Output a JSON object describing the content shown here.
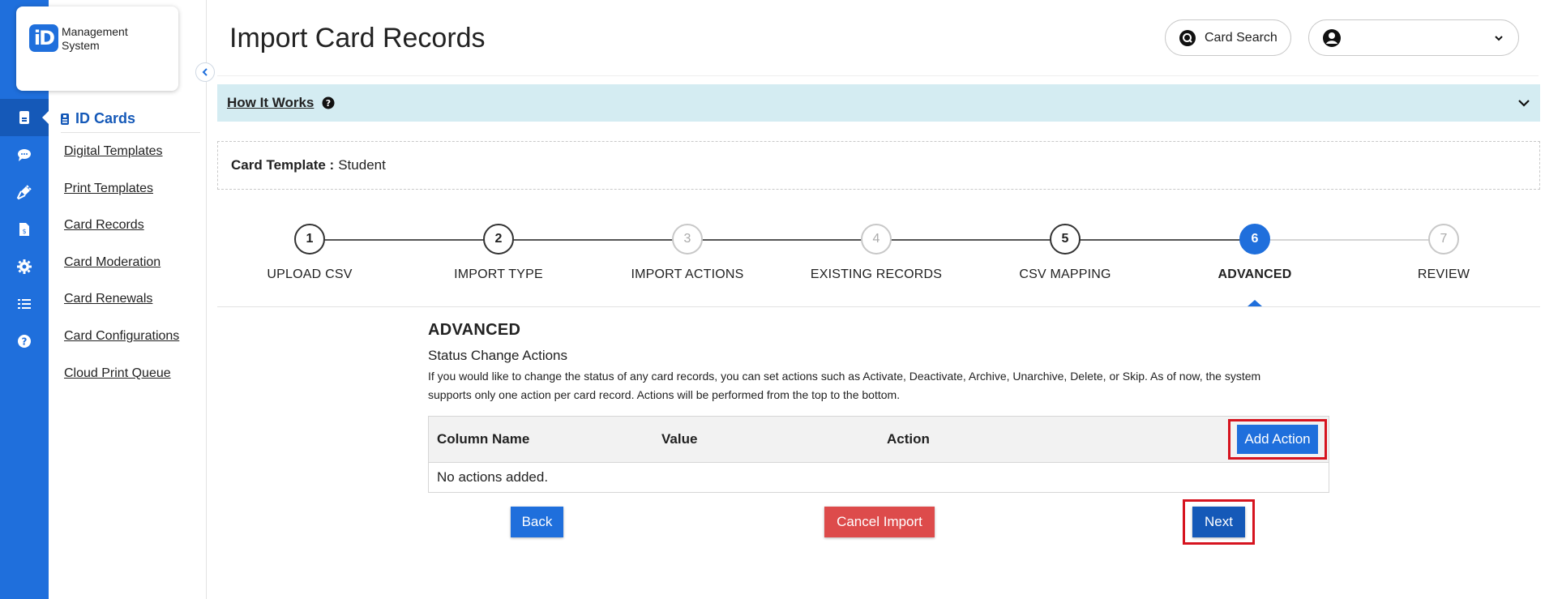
{
  "rail": {
    "icons": [
      "id-card-icon",
      "chat-icon",
      "plug-icon",
      "document-icon",
      "gear-icon",
      "list-icon",
      "help-icon"
    ]
  },
  "sidebar": {
    "logo_text_line1": "Management",
    "logo_text_line2": "System",
    "logo_badge": "iD",
    "section_title": "ID Cards",
    "items": [
      {
        "label": "Digital Templates"
      },
      {
        "label": "Print Templates"
      },
      {
        "label": "Card Records"
      },
      {
        "label": "Card Moderation"
      },
      {
        "label": "Card Renewals"
      },
      {
        "label": "Card Configurations"
      },
      {
        "label": "Cloud Print Queue"
      }
    ]
  },
  "header": {
    "title": "Import Card Records",
    "card_search_label": "Card Search"
  },
  "how_it_works": {
    "label": "How It Works"
  },
  "template": {
    "label": "Card Template :",
    "value": "Student"
  },
  "stepper": {
    "steps": [
      {
        "num": "1",
        "label": "UPLOAD CSV",
        "state": "done"
      },
      {
        "num": "2",
        "label": "IMPORT TYPE",
        "state": "done"
      },
      {
        "num": "3",
        "label": "IMPORT ACTIONS",
        "state": "skipped"
      },
      {
        "num": "4",
        "label": "EXISTING RECORDS",
        "state": "skipped"
      },
      {
        "num": "5",
        "label": "CSV MAPPING",
        "state": "done"
      },
      {
        "num": "6",
        "label": "ADVANCED",
        "state": "active"
      },
      {
        "num": "7",
        "label": "REVIEW",
        "state": "pending"
      }
    ]
  },
  "advanced": {
    "title": "ADVANCED",
    "subtitle": "Status Change Actions",
    "description_line1": "If you would like to change the status of any card records, you can set actions such as Activate, Deactivate, Archive, Unarchive, Delete, or Skip. As of now, the system",
    "description_line2": "supports only one action per card record. Actions will be performed from the top to the bottom.",
    "table": {
      "columns": [
        "Column Name",
        "Value",
        "Action"
      ],
      "add_action_label": "Add Action",
      "empty_text": "No actions added."
    }
  },
  "footer": {
    "back_label": "Back",
    "cancel_label": "Cancel Import",
    "next_label": "Next"
  },
  "colors": {
    "primary": "#1f6fdc",
    "primary_dark": "#1559b8",
    "danger": "#dd4b4b",
    "highlight": "#d6141f",
    "info_bar": "#d4ecf2"
  }
}
